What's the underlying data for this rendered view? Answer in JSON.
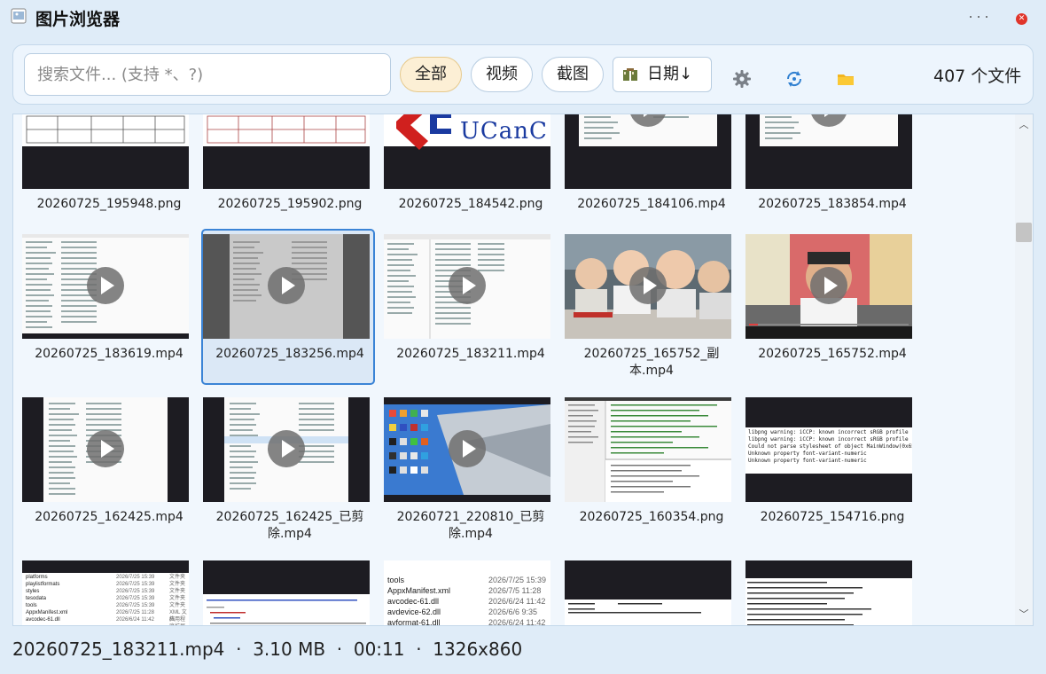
{
  "window": {
    "title": "图片浏览器"
  },
  "toolbar": {
    "search_placeholder": "搜索文件... (支持 *、?)",
    "filters": [
      "全部",
      "视频",
      "截图"
    ],
    "active_filter": "全部",
    "sort_label": "日期↓",
    "count_label": "407 个文件",
    "accent_color": "#fcefd5",
    "icons": [
      "settings-gear-icon",
      "refresh-icon",
      "folder-icon"
    ]
  },
  "files": [
    {
      "name": "20260725_195948.png",
      "type": "png"
    },
    {
      "name": "20260725_195902.png",
      "type": "png"
    },
    {
      "name": "20260725_184542.png",
      "type": "png",
      "logo_text": "UCanC"
    },
    {
      "name": "20260725_184106.mp4",
      "type": "mp4"
    },
    {
      "name": "20260725_183854.mp4",
      "type": "mp4"
    },
    {
      "name": "20260725_183619.mp4",
      "type": "mp4"
    },
    {
      "name": "20260725_183256.mp4",
      "type": "mp4",
      "selected": true
    },
    {
      "name": "20260725_183211.mp4",
      "type": "mp4"
    },
    {
      "name": "20260725_165752_副本.mp4",
      "type": "mp4"
    },
    {
      "name": "20260725_165752.mp4",
      "type": "mp4"
    },
    {
      "name": "20260725_162425.mp4",
      "type": "mp4"
    },
    {
      "name": "20260725_162425_已剪除.mp4",
      "type": "mp4"
    },
    {
      "name": "20260721_220810_已剪除.mp4",
      "type": "mp4"
    },
    {
      "name": "20260725_160354.png",
      "type": "png"
    },
    {
      "name": "20260725_154716.png",
      "type": "png"
    },
    {
      "name": "",
      "type": "png"
    },
    {
      "name": "",
      "type": "png"
    },
    {
      "name": "",
      "type": "png"
    },
    {
      "name": "",
      "type": "png"
    },
    {
      "name": "",
      "type": "png"
    }
  ],
  "console_lines": [
    "libpng warning: iCCP: known incorrect sRGB profile",
    "libpng warning: iCCP: known incorrect sRGB profile",
    "Could not parse stylesheet of object MainWindow(0x65bf950",
    "Unknown property font-variant-numeric",
    "Unknown property font-variant-numeric"
  ],
  "explorer_rows": [
    {
      "name": "platforms",
      "date": "2026/7/25 15:39",
      "kind": "文件夹"
    },
    {
      "name": "playlistformats",
      "date": "2026/7/25 15:39",
      "kind": "文件夹"
    },
    {
      "name": "styles",
      "date": "2026/7/25 15:39",
      "kind": "文件夹"
    },
    {
      "name": "tesodata",
      "date": "2026/7/25 15:39",
      "kind": "文件夹"
    },
    {
      "name": "tools",
      "date": "2026/7/25 15:39",
      "kind": "文件夹"
    },
    {
      "name": "AppxManifest.xml",
      "date": "2026/7/25 11:28",
      "kind": "XML 文档"
    },
    {
      "name": "avcodec-61.dll",
      "date": "2026/6/24 11:42",
      "kind": "应用程序扩展"
    }
  ],
  "explorer_rows_large": [
    {
      "name": "tools",
      "date": "2026/7/25 15:39"
    },
    {
      "name": "AppxManifest.xml",
      "date": "2026/7/5 11:28"
    },
    {
      "name": "avcodec-61.dll",
      "date": "2026/6/24 11:42"
    },
    {
      "name": "avdevice-62.dll",
      "date": "2026/6/6 9:35"
    },
    {
      "name": "avformat-61.dll",
      "date": "2026/6/24 11:42"
    }
  ],
  "status": {
    "text": "20260725_183211.mp4  ·  3.10 MB  ·  00:11  ·  1326x860"
  }
}
